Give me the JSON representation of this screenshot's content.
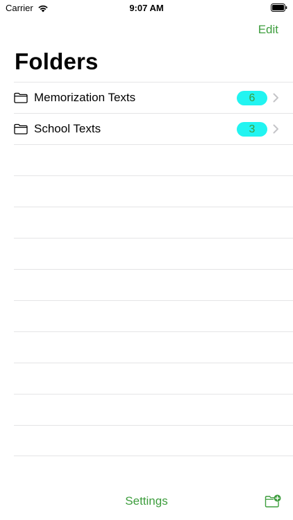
{
  "status_bar": {
    "carrier": "Carrier",
    "time": "9:07 AM",
    "wifi_icon": "wifi-icon",
    "battery_icon": "battery-icon"
  },
  "nav": {
    "edit_label": "Edit"
  },
  "page": {
    "title": "Folders"
  },
  "folders": [
    {
      "name": "Memorization Texts",
      "count": "6",
      "icon": "folder-icon"
    },
    {
      "name": "School Texts",
      "count": "3",
      "icon": "folder-icon"
    }
  ],
  "toolbar": {
    "settings_label": "Settings",
    "new_folder_icon": "folder-plus-icon"
  },
  "colors": {
    "accent": "#3d9d3d",
    "badge_background": "#22f4f1",
    "separator": "#e4e4e6"
  }
}
